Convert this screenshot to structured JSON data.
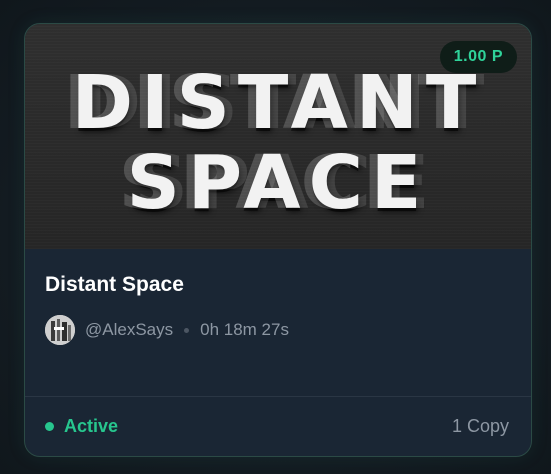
{
  "card": {
    "thumbnail_title_line1": "DISTANT",
    "thumbnail_title_line2": "SPACE",
    "price": "1.00 P",
    "title": "Distant Space",
    "author": "@AlexSays",
    "duration": "0h 18m 27s",
    "status": "Active",
    "copies": "1 Copy"
  },
  "colors": {
    "accent_green": "#27c68e",
    "card_background": "#1a2634",
    "card_border": "#2b4a45",
    "muted_text": "#8d97a3"
  },
  "icons": {
    "avatar": "avatar-icon",
    "status": "status-dot-icon"
  }
}
